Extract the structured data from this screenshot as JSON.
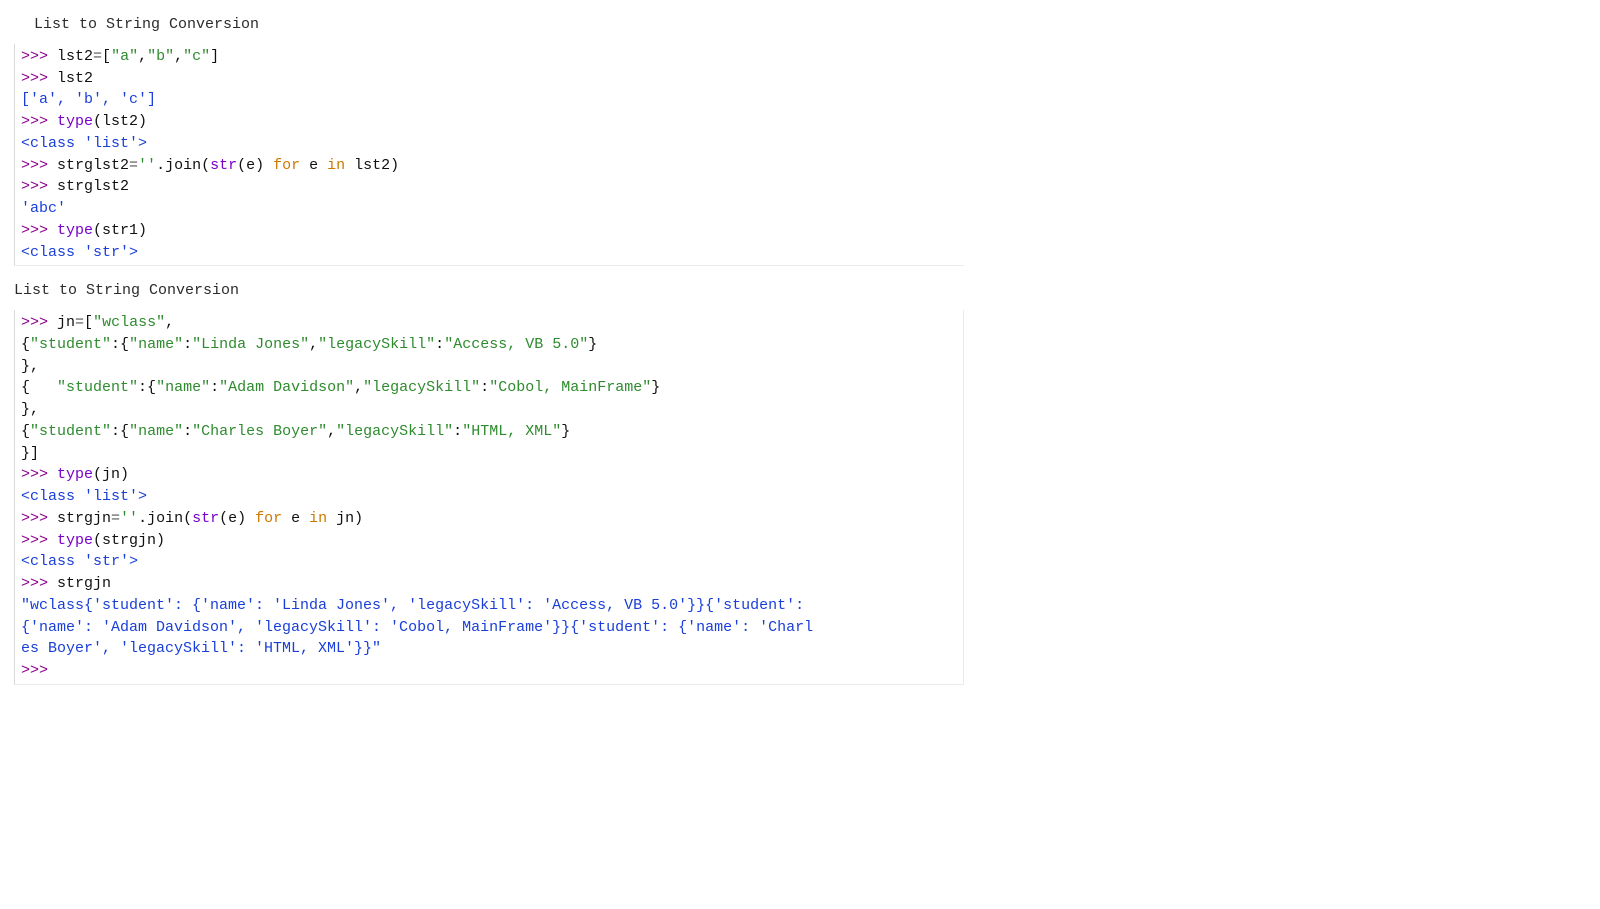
{
  "headings": {
    "h1": " List to String Conversion",
    "h2": "List to String Conversion"
  },
  "block1": {
    "l1_prompt": ">>> ",
    "l1_lhs": "lst2",
    "l1_eq": "=",
    "l1_br_open": "[",
    "l1_s1": "\"a\"",
    "l1_c1": ",",
    "l1_s2": "\"b\"",
    "l1_c2": ",",
    "l1_s3": "\"c\"",
    "l1_br_close": "]",
    "l2_prompt": ">>> ",
    "l2_text": "lst2",
    "l3_out": "['a', 'b', 'c']",
    "l4_prompt": ">>> ",
    "l4_call": "type",
    "l4_arg": "(lst2)",
    "l5_out": "<class 'list'>",
    "l6_prompt": ">>> ",
    "l6_lhs": "strglst2",
    "l6_eq": "=",
    "l6_empty": "''",
    "l6_dot": ".join(",
    "l6_str": "str",
    "l6_paren": "(e) ",
    "l6_for": "for",
    "l6_mid": " e ",
    "l6_in": "in",
    "l6_tail": " lst2)",
    "l7_prompt": ">>> ",
    "l7_text": "strglst2",
    "l8_out": "'abc'",
    "l9_prompt": ">>> ",
    "l9_call": "type",
    "l9_arg": "(str1)",
    "l10_out": "<class 'str'>"
  },
  "block2": {
    "l1_prompt": ">>> ",
    "l1_lhs": "jn",
    "l1_eq": "=",
    "l1_open": "[",
    "l1_s1": "\"wclass\"",
    "l1_c1": ",",
    "l2_open": "{",
    "l2_k1": "\"student\"",
    "l2_co1": ":",
    "l2_open2": "{",
    "l2_k2": "\"name\"",
    "l2_co2": ":",
    "l2_v2": "\"Linda Jones\"",
    "l2_c2": ",",
    "l2_k3": "\"legacySkill\"",
    "l2_co3": ":",
    "l2_v3": "\"Access, VB 5.0\"",
    "l2_close2": "}",
    "l3_close": "},",
    "l4_open": "{   ",
    "l4_k1": "\"student\"",
    "l4_co1": ":",
    "l4_open2": "{",
    "l4_k2": "\"name\"",
    "l4_co2": ":",
    "l4_v2": "\"Adam Davidson\"",
    "l4_c2": ",",
    "l4_k3": "\"legacySkill\"",
    "l4_co3": ":",
    "l4_v3": "\"Cobol, MainFrame\"",
    "l4_close2": "}",
    "l5_close": "},",
    "l6_open": "{",
    "l6_k1": "\"student\"",
    "l6_co1": ":",
    "l6_open2": "{",
    "l6_k2": "\"name\"",
    "l6_co2": ":",
    "l6_v2": "\"Charles Boyer\"",
    "l6_c2": ",",
    "l6_k3": "\"legacySkill\"",
    "l6_co3": ":",
    "l6_v3": "\"HTML, XML\"",
    "l6_close2": "}",
    "l7_close": "}]",
    "l8_prompt": ">>> ",
    "l8_call": "type",
    "l8_arg": "(jn)",
    "l9_out": "<class 'list'>",
    "l10_prompt": ">>> ",
    "l10_lhs": "strgjn",
    "l10_eq": "=",
    "l10_empty": "''",
    "l10_dot": ".join(",
    "l10_str": "str",
    "l10_paren": "(e) ",
    "l10_for": "for",
    "l10_mid": " e ",
    "l10_in": "in",
    "l10_tail": " jn)",
    "l11_prompt": ">>> ",
    "l11_call": "type",
    "l11_arg": "(strgjn)",
    "l12_out": "<class 'str'>",
    "l13_prompt": ">>> ",
    "l13_text": "strgjn",
    "l14_out1": "\"wclass{'student': {'name': 'Linda Jones', 'legacySkill': 'Access, VB 5.0'}}{'student':",
    "l14_out2": "{'name': 'Adam Davidson', 'legacySkill': 'Cobol, MainFrame'}}{'student': {'name': 'Charl",
    "l14_out3": "es Boyer', 'legacySkill': 'HTML, XML'}}\"",
    "l15_prompt": ">>>"
  }
}
